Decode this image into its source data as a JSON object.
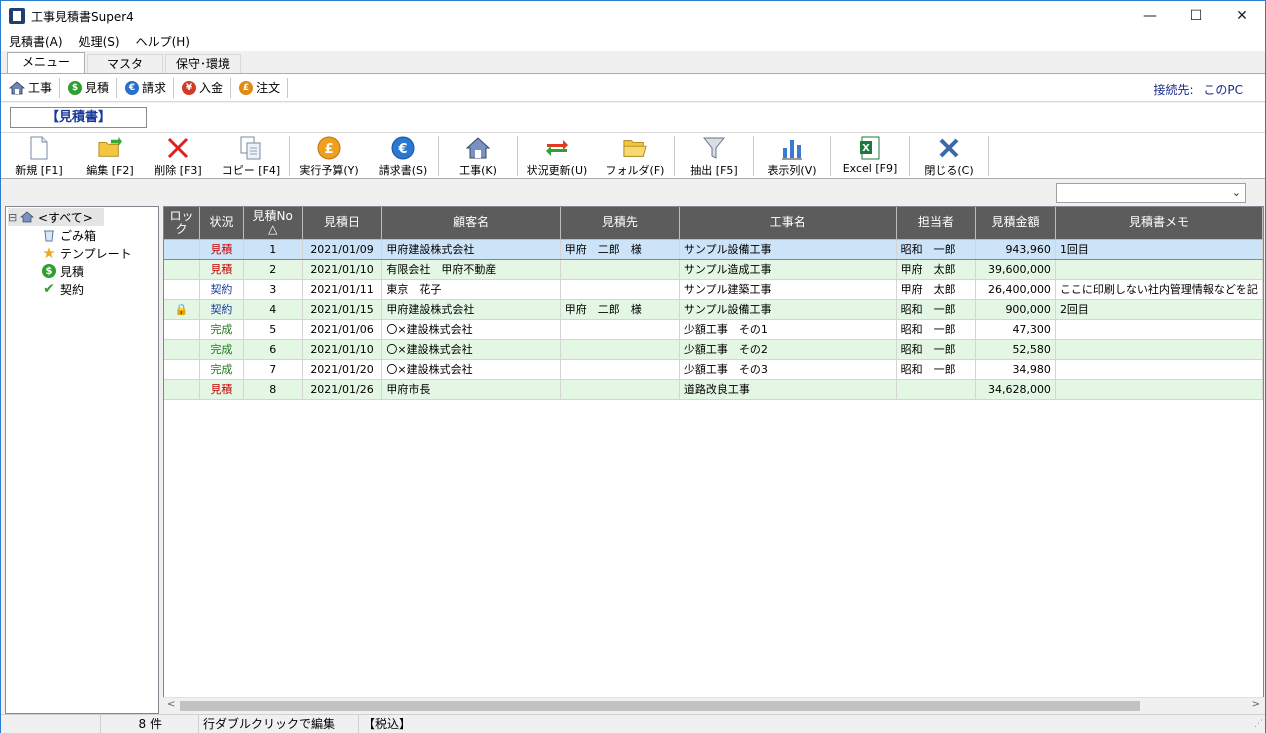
{
  "window": {
    "title": "工事見積書Super4",
    "minimize": "—",
    "maximize": "☐",
    "close": "✕"
  },
  "menu": [
    "見積書(A)",
    "処理(S)",
    "ヘルプ(H)"
  ],
  "tabs": [
    "メニュー",
    "マスタ",
    "保守･環境"
  ],
  "nav": {
    "items": [
      {
        "label": "工事",
        "icon": "house-icon",
        "color": "#5577aa"
      },
      {
        "label": "見積",
        "icon": "dollar-coin-icon",
        "color": "#2e9e2e"
      },
      {
        "label": "請求",
        "icon": "euro-coin-icon",
        "color": "#2a6fc9"
      },
      {
        "label": "入金",
        "icon": "yen-coin-icon",
        "color": "#d23a2a"
      },
      {
        "label": "注文",
        "icon": "pound-coin-icon",
        "color": "#e08a10"
      }
    ],
    "connection_label": "接続先:",
    "connection_value": "このPC"
  },
  "section_title": "【見積書】",
  "toolbar": [
    "新規 [F1]",
    "編集 [F2]",
    "削除 [F3]",
    "コピー [F4]",
    "実行予算(Y)",
    "請求書(S)",
    "工事(K)",
    "状況更新(U)",
    "フォルダ(F)",
    "抽出 [F5]",
    "表示列(V)",
    "Excel [F9]",
    "閉じる(C)"
  ],
  "filter": {
    "selected": ""
  },
  "tree": {
    "root": "<すべて>",
    "expander": "⊟",
    "children": [
      "ごみ箱",
      "テンプレート",
      "見積",
      "契約"
    ]
  },
  "grid": {
    "columns": [
      "ロック",
      "状況",
      "見積No",
      "見積日",
      "顧客名",
      "見積先",
      "工事名",
      "担当者",
      "見積金額",
      "見積書メモ"
    ],
    "sort_marker": "△",
    "rows": [
      {
        "lock": "",
        "status": "見積",
        "no": "1",
        "date": "2021/01/09",
        "customer": "甲府建設株式会社",
        "dest": "甲府　二郎　様",
        "project": "サンプル設備工事",
        "staff": "昭和　一郎",
        "amount": "943,960",
        "memo": "1回目"
      },
      {
        "lock": "",
        "status": "見積",
        "no": "2",
        "date": "2021/01/10",
        "customer": "有限会社　甲府不動産",
        "dest": "",
        "project": "サンプル造成工事",
        "staff": "甲府　太郎",
        "amount": "39,600,000",
        "memo": ""
      },
      {
        "lock": "",
        "status": "契約",
        "no": "3",
        "date": "2021/01/11",
        "customer": "東京　花子",
        "dest": "",
        "project": "サンプル建築工事",
        "staff": "甲府　太郎",
        "amount": "26,400,000",
        "memo": "ここに印刷しない社内管理情報などを記"
      },
      {
        "lock": "🔒",
        "status": "契約",
        "no": "4",
        "date": "2021/01/15",
        "customer": "甲府建設株式会社",
        "dest": "甲府　二郎　様",
        "project": "サンプル設備工事",
        "staff": "昭和　一郎",
        "amount": "900,000",
        "memo": "2回目"
      },
      {
        "lock": "",
        "status": "完成",
        "no": "5",
        "date": "2021/01/06",
        "customer": "〇×建設株式会社",
        "dest": "",
        "project": "少額工事　その1",
        "staff": "昭和　一郎",
        "amount": "47,300",
        "memo": ""
      },
      {
        "lock": "",
        "status": "完成",
        "no": "6",
        "date": "2021/01/10",
        "customer": "〇×建設株式会社",
        "dest": "",
        "project": "少額工事　その2",
        "staff": "昭和　一郎",
        "amount": "52,580",
        "memo": ""
      },
      {
        "lock": "",
        "status": "完成",
        "no": "7",
        "date": "2021/01/20",
        "customer": "〇×建設株式会社",
        "dest": "",
        "project": "少額工事　その3",
        "staff": "昭和　一郎",
        "amount": "34,980",
        "memo": ""
      },
      {
        "lock": "",
        "status": "見積",
        "no": "8",
        "date": "2021/01/26",
        "customer": "甲府市長",
        "dest": "",
        "project": "道路改良工事",
        "staff": "",
        "amount": "34,628,000",
        "memo": ""
      }
    ]
  },
  "status": {
    "count": "8 件",
    "hint": "行ダブルクリックで編集",
    "tax": "【税込】"
  },
  "scroll": {
    "left": "<",
    "right": ">"
  }
}
